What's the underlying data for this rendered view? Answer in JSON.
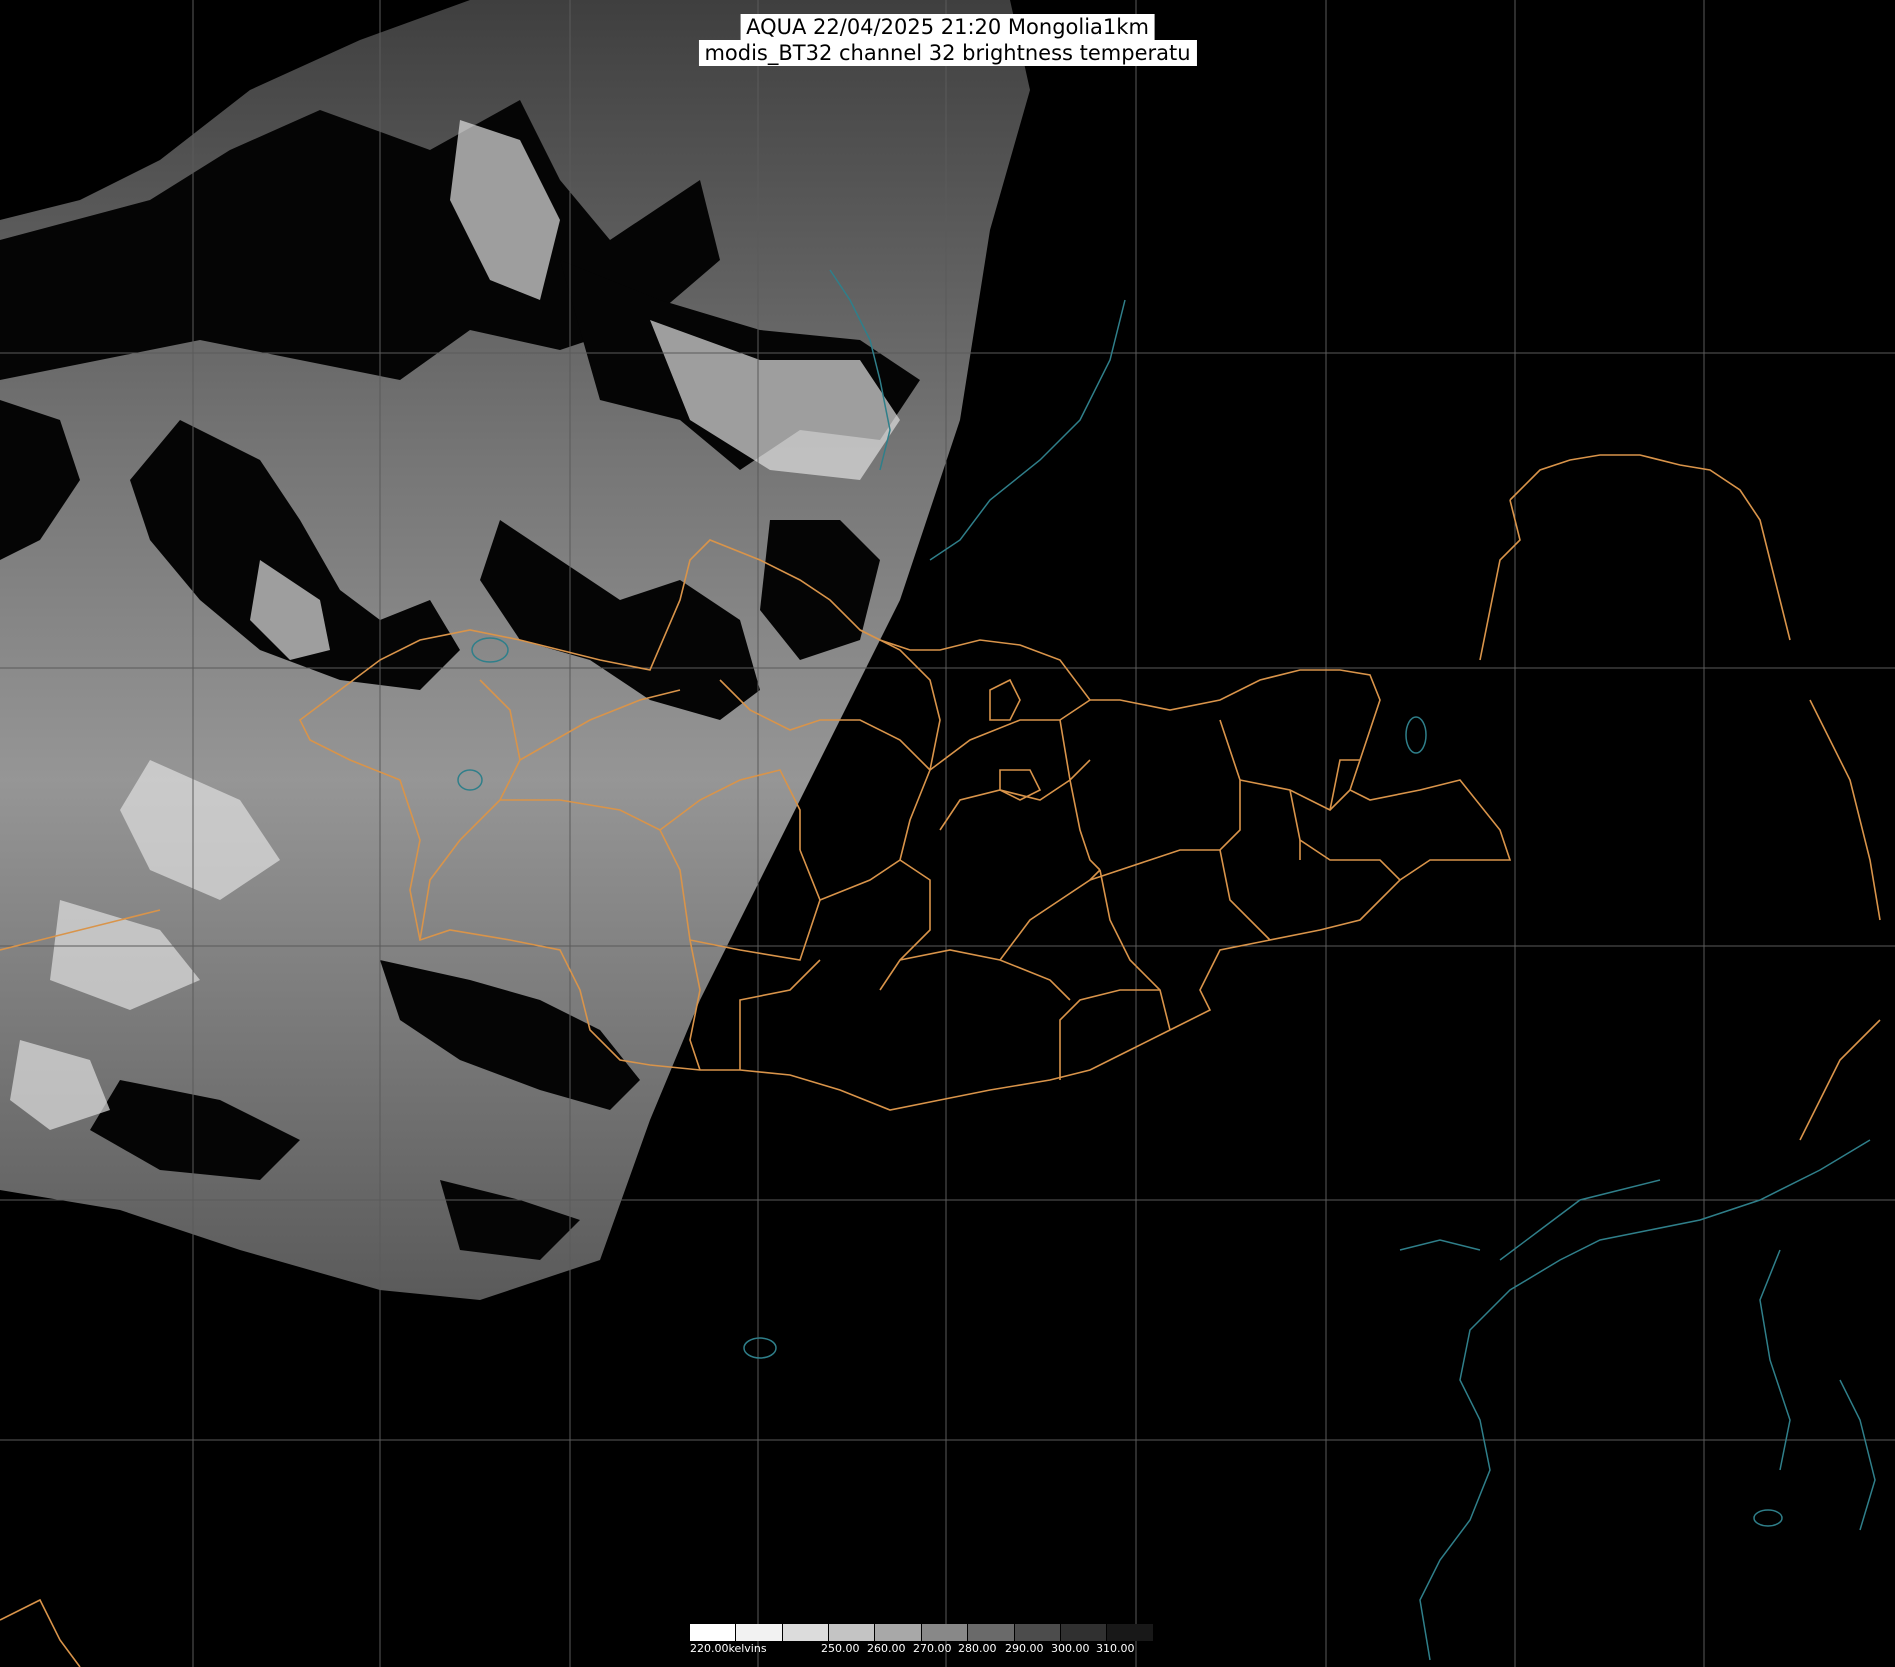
{
  "title": {
    "line1": "AQUA 22/04/2025 21:20 Mongolia1km",
    "line2": "modis_BT32 channel 32 brightness temperatu"
  },
  "legend": {
    "min_label": "220.00kelvins",
    "ticks": [
      "250.00",
      "260.00",
      "270.00",
      "280.00",
      "290.00",
      "300.00",
      "310.00"
    ],
    "gradient": [
      "#ffffff",
      "#f2f2f2",
      "#dcdcdc",
      "#c4c4c4",
      "#a8a8a8",
      "#888888",
      "#6a6a6a",
      "#4c4c4c",
      "#303030",
      "#181818",
      "#000000"
    ]
  },
  "colors": {
    "background": "#000000",
    "grid": "#5a5a5a",
    "borders": "#d9944a",
    "coast": "#2f7f8a",
    "imagery_light": "#e6e6e6",
    "imagery_dark": "#1a1a1a"
  }
}
